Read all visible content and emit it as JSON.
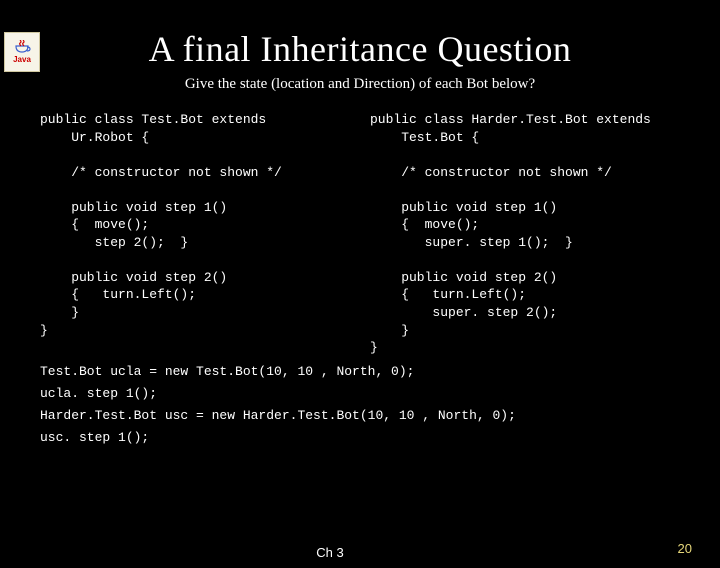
{
  "logo": {
    "text": "Java"
  },
  "title": "A final Inheritance Question",
  "subtitle": "Give the state (location and Direction) of each Bot below?",
  "code": {
    "left": "public class Test.Bot extends\n    Ur.Robot {\n\n    /* constructor not shown */\n\n    public void step 1()\n    {  move();\n       step 2();  }\n\n    public void step 2()\n    {   turn.Left();\n    }\n}",
    "right": "public class Harder.Test.Bot extends\n    Test.Bot {\n\n    /* constructor not shown */\n\n    public void step 1()\n    {  move();\n       super. step 1();  }\n\n    public void step 2()\n    {   turn.Left();\n        super. step 2();\n    }\n}"
  },
  "bottom": "Test.Bot ucla = new Test.Bot(10, 10 , North, 0);\nucla. step 1();\nHarder.Test.Bot usc = new Harder.Test.Bot(10, 10 , North, 0);\nusc. step 1();",
  "chapter": "Ch 3",
  "slidenum": "20"
}
